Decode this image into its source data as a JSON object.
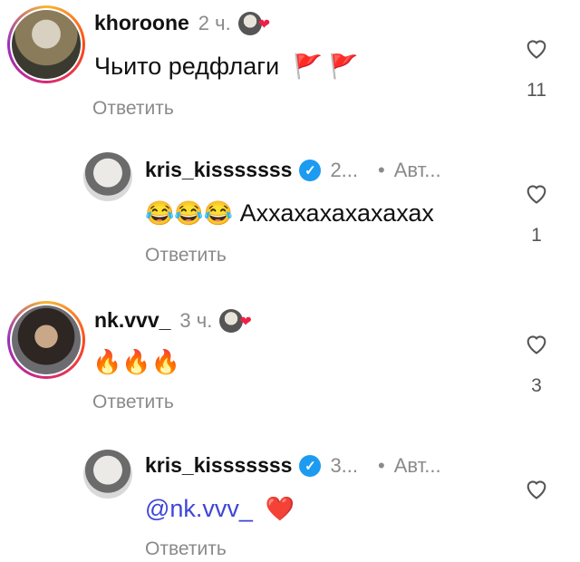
{
  "comments": [
    {
      "username": "khoroone",
      "time": "2 ч.",
      "text": "Чьито редфлаги",
      "emoji": "🚩 🚩",
      "reply": "Ответить",
      "likes": "11"
    },
    {
      "username": "kris_kisssssss",
      "time": "2...",
      "author": "Авт...",
      "emoji": "😂😂😂",
      "text": "Аххахахахахахах",
      "reply": "Ответить",
      "likes": "1"
    },
    {
      "username": "nk.vvv_",
      "time": "3 ч.",
      "emoji": "🔥🔥🔥",
      "reply": "Ответить",
      "likes": "3"
    },
    {
      "username": "kris_kisssssss",
      "time": "3...",
      "author": "Авт...",
      "mention": "@nk.vvv_",
      "emoji": "❤️",
      "reply": "Ответить",
      "likes": ""
    }
  ],
  "colors": {
    "mention": "#3e45d8",
    "heart": "#ed2146",
    "verified": "#1d9bf0"
  }
}
